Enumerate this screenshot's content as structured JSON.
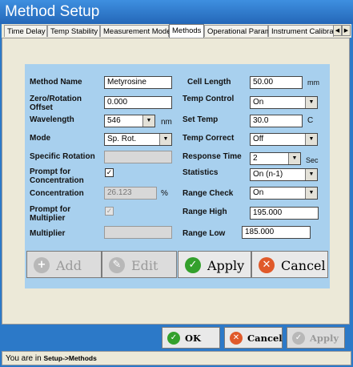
{
  "window_title": "Method Setup",
  "tabs": [
    "Time Delay",
    "Temp Stability",
    "Measurement Mode",
    "Methods",
    "Operational Param",
    "Instrument Calibrat"
  ],
  "left": {
    "method_name_label": "Method Name",
    "method_name_value": "Metyrosine",
    "zero_label": "Zero/Rotation Offset",
    "zero_value": "0.000",
    "wavelength_label": "Wavelength",
    "wavelength_value": "546",
    "wavelength_unit": "nm",
    "mode_label": "Mode",
    "mode_value": "Sp. Rot.",
    "specific_rotation_label": "Specific Rotation",
    "specific_rotation_value": "",
    "prompt_concentration_label": "Prompt for Concentration",
    "prompt_concentration_checked": true,
    "concentration_label": "Concentration",
    "concentration_value": "26.123",
    "concentration_unit": "%",
    "prompt_multiplier_label": "Prompt for Multiplier",
    "prompt_multiplier_checked": true,
    "multiplier_label": "Multiplier",
    "multiplier_value": ""
  },
  "right": {
    "cell_length_label": "Cell Length",
    "cell_length_value": "50.00",
    "cell_length_unit": "mm",
    "temp_control_label": "Temp Control",
    "temp_control_value": "On",
    "set_temp_label": "Set Temp",
    "set_temp_value": "30.0",
    "set_temp_unit": "C",
    "temp_correct_label": "Temp Correct",
    "temp_correct_value": "Off",
    "response_time_label": "Response Time",
    "response_time_value": "2",
    "response_time_unit": "Sec",
    "statistics_label": "Statistics",
    "statistics_value": "On (n-1)",
    "range_check_label": "Range Check",
    "range_check_value": "On",
    "range_high_label": "Range High",
    "range_high_value": "195.000",
    "range_low_label": "Range Low",
    "range_low_value": "185.000"
  },
  "panel_buttons": {
    "add": "Add",
    "edit": "Edit",
    "apply": "Apply",
    "cancel": "Cancel"
  },
  "dialog_buttons": {
    "ok": "OK",
    "cancel": "Cancel",
    "apply": "Apply"
  },
  "footer": {
    "prefix": "You are in",
    "path": "Setup->Methods"
  },
  "icons": {
    "check": "check-icon",
    "cross": "close-icon",
    "plus": "plus-icon",
    "edit": "edit-icon"
  },
  "colors": {
    "title_bar": "#2467b8",
    "panel": "#a8d0ee",
    "accent_green": "#33a02c",
    "accent_red": "#e05a2a"
  }
}
